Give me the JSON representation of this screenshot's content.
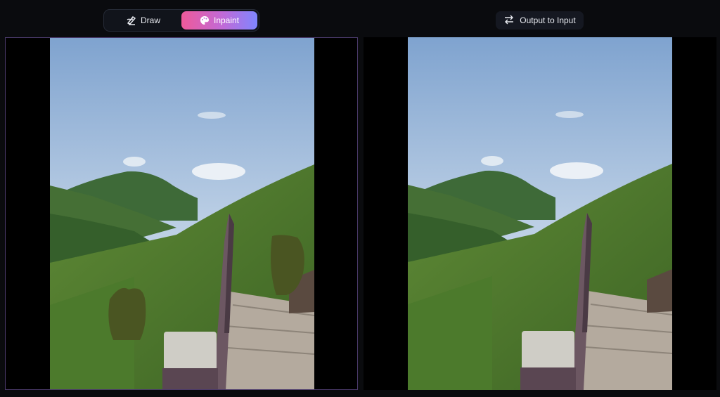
{
  "toolbar": {
    "modes": [
      {
        "label": "Draw",
        "icon": "pen-icon",
        "active": false
      },
      {
        "label": "Inpaint",
        "icon": "palette-icon",
        "active": true
      }
    ],
    "output_to_input_label": "Output to Input",
    "output_to_input_icon": "swap-arrows-icon"
  },
  "colors": {
    "background": "#0a0b0e",
    "inpaint_gradient_start": "#ee5a9a",
    "inpaint_gradient_end": "#7f86ff",
    "mask_color": "#4a5522"
  },
  "panels": {
    "input": {
      "name": "input-image",
      "has_mask": true
    },
    "output": {
      "name": "output-image",
      "has_mask": false
    }
  }
}
